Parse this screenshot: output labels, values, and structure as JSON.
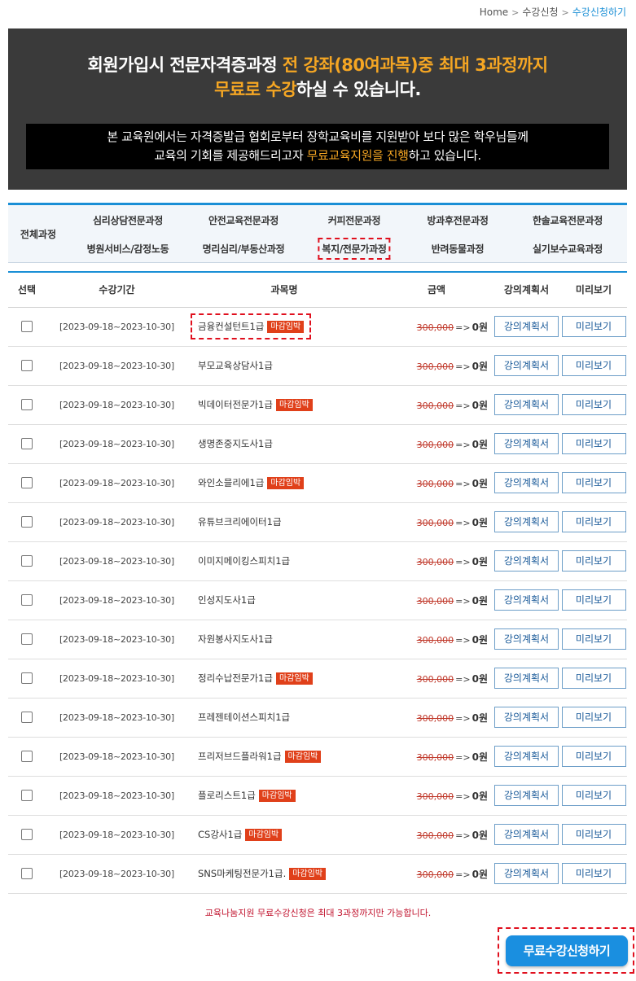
{
  "breadcrumb": {
    "home": "Home",
    "parent": "수강신청",
    "current": "수강신청하기"
  },
  "banner": {
    "line1_a": "회원가입시 전문자격증과정 ",
    "line1_b": "전 강좌(80여과목)중 최대 3과정까지",
    "line2_a": "무료로 수강",
    "line2_b": "하실 수 있습니다.",
    "box_line1": "본 교육원에서는 자격증발급 협회로부터 장학교육비를 지원받아 보다 많은 학우님들께",
    "box_line2_a": "교육의 기회를 제공해드리고자 ",
    "box_line2_b": "무료교육지원을 진행",
    "box_line2_c": "하고 있습니다."
  },
  "categories": {
    "all": "전체과정",
    "row1": [
      "심리상담전문과정",
      "안전교육전문과정",
      "커피전문과정",
      "방과후전문과정",
      "한솔교육전문과정"
    ],
    "row2": [
      "병원서비스/감정노동",
      "명리심리/부동산과정",
      "복지/전문가과정",
      "반려동물과정",
      "실기보수교육과정"
    ]
  },
  "table": {
    "headers": {
      "select": "선택",
      "period": "수강기간",
      "name": "과목명",
      "price": "금액",
      "plan": "강의계획서",
      "preview": "미리보기"
    },
    "plan_label": "강의계획서",
    "preview_label": "미리보기",
    "arrow": "=>",
    "rows": [
      {
        "period": "[2023-09-18~2023-10-30]",
        "name": "금융컨설턴트1급",
        "badge": "마감임박",
        "old_price": "300,000",
        "new_price": "0원"
      },
      {
        "period": "[2023-09-18~2023-10-30]",
        "name": "부모교육상담사1급",
        "badge": "",
        "old_price": "300,000",
        "new_price": "0원"
      },
      {
        "period": "[2023-09-18~2023-10-30]",
        "name": "빅데이터전문가1급",
        "badge": "마감임박",
        "old_price": "300,000",
        "new_price": "0원"
      },
      {
        "period": "[2023-09-18~2023-10-30]",
        "name": "생명존중지도사1급",
        "badge": "",
        "old_price": "300,000",
        "new_price": "0원"
      },
      {
        "period": "[2023-09-18~2023-10-30]",
        "name": "와인소믈리에1급",
        "badge": "마감임박",
        "old_price": "300,000",
        "new_price": "0원"
      },
      {
        "period": "[2023-09-18~2023-10-30]",
        "name": "유튜브크리에이터1급",
        "badge": "",
        "old_price": "300,000",
        "new_price": "0원"
      },
      {
        "period": "[2023-09-18~2023-10-30]",
        "name": "이미지메이킹스피치1급",
        "badge": "",
        "old_price": "300,000",
        "new_price": "0원"
      },
      {
        "period": "[2023-09-18~2023-10-30]",
        "name": "인성지도사1급",
        "badge": "",
        "old_price": "300,000",
        "new_price": "0원"
      },
      {
        "period": "[2023-09-18~2023-10-30]",
        "name": "자원봉사지도사1급",
        "badge": "",
        "old_price": "300,000",
        "new_price": "0원"
      },
      {
        "period": "[2023-09-18~2023-10-30]",
        "name": "정리수납전문가1급",
        "badge": "마감임박",
        "old_price": "300,000",
        "new_price": "0원"
      },
      {
        "period": "[2023-09-18~2023-10-30]",
        "name": "프레젠테이션스피치1급",
        "badge": "",
        "old_price": "300,000",
        "new_price": "0원"
      },
      {
        "period": "[2023-09-18~2023-10-30]",
        "name": "프리저브드플라워1급",
        "badge": "마감임박",
        "old_price": "300,000",
        "new_price": "0원"
      },
      {
        "period": "[2023-09-18~2023-10-30]",
        "name": "플로리스트1급",
        "badge": "마감임박",
        "old_price": "300,000",
        "new_price": "0원"
      },
      {
        "period": "[2023-09-18~2023-10-30]",
        "name": "CS강사1급",
        "badge": "마감임박",
        "old_price": "300,000",
        "new_price": "0원"
      },
      {
        "period": "[2023-09-18~2023-10-30]",
        "name": "SNS마케팅전문가1급.",
        "badge": "마감임박",
        "old_price": "300,000",
        "new_price": "0원"
      }
    ]
  },
  "notice": "교육나눔지원 무료수강신청은 최대 3과정까지만 가능합니다.",
  "submit_label": "무료수강신청하기",
  "colors": {
    "accent": "#1a8fd6",
    "highlight": "#f5a623",
    "badge": "#e0401a",
    "notice": "#c0102b"
  }
}
